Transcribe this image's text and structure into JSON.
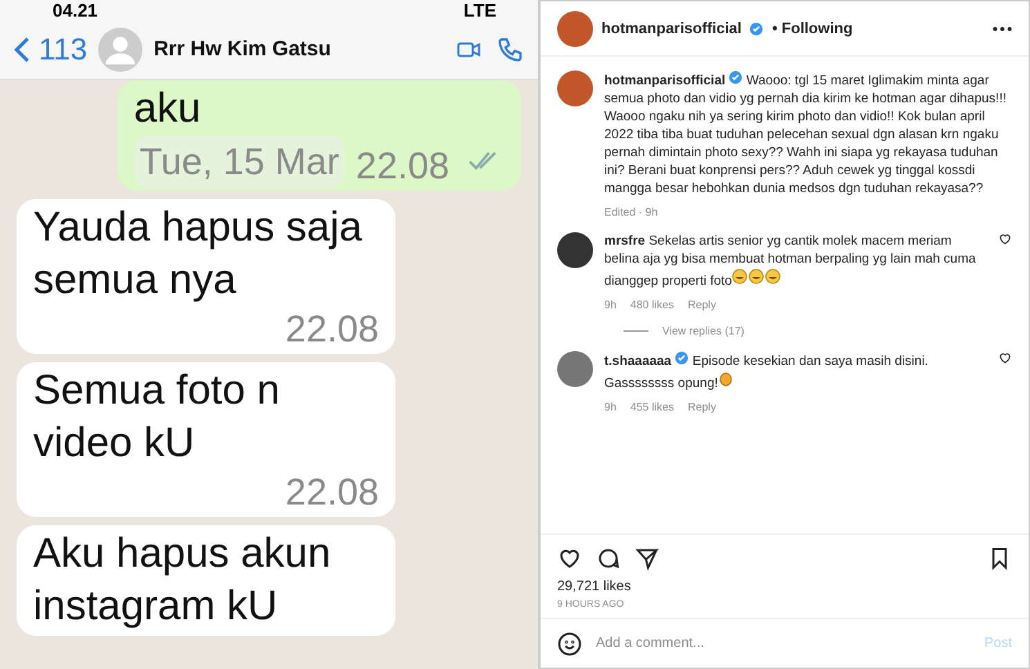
{
  "chat": {
    "status_bar": {
      "time": "04.21",
      "network": "LTE"
    },
    "header": {
      "back_count": "113",
      "contact_name": "Rrr Hw Kim Gatsu"
    },
    "messages": [
      {
        "kind": "outgoing",
        "text": "aku",
        "date_chip": "Tue, 15 Mar",
        "time": "22.08",
        "read": true
      },
      {
        "kind": "incoming",
        "text": "Yauda hapus saja semua nya",
        "time": "22.08"
      },
      {
        "kind": "incoming",
        "text": "Semua foto n video kU",
        "time": "22.08"
      },
      {
        "kind": "incoming",
        "text": "Aku hapus akun instagram kU"
      }
    ]
  },
  "post": {
    "header": {
      "username": "hotmanparisofficial",
      "verified": true,
      "following": "• Following"
    },
    "caption": {
      "username": "hotmanparisofficial",
      "verified": true,
      "text": "Waooo: tgl 15 maret Iglimakim minta agar semua photo dan vidio yg pernah dia kirim ke hotman agar dihapus!!! Waooo ngaku nih ya sering kirim photo dan vidio!! Kok bulan april 2022 tiba tiba buat tuduhan pelecehan sexual dgn alasan krn ngaku pernah dimintain photo sexy?? Wahh ini siapa yg rekayasa tuduhan ini? Berani buat konprensi pers?? Aduh cewek yg tinggal kossdi mangga besar hebohkan dunia medsos dgn tuduhan rekayasa??",
      "meta": "Edited · 9h"
    },
    "comments": [
      {
        "username": "mrsfre",
        "verified": false,
        "text": "Sekelas artis senior yg cantik molek macem meriam belina aja yg bisa membuat hotman berpaling yg lain mah cuma dianggep properti foto",
        "kind": "laugh",
        "time": "9h",
        "likes": "480 likes",
        "reply": "Reply",
        "view_replies": "View replies (17)"
      },
      {
        "username": "t.shaaaaaa",
        "verified": true,
        "text": "Episode kesekian dan saya masih disini. Gassssssss opung!",
        "kind": "clap",
        "time": "9h",
        "likes": "455 likes",
        "reply": "Reply"
      }
    ],
    "likes": "29,721 likes",
    "posted": "9 HOURS AGO",
    "comment_box": {
      "placeholder": "Add a comment...",
      "post_button": "Post"
    }
  }
}
